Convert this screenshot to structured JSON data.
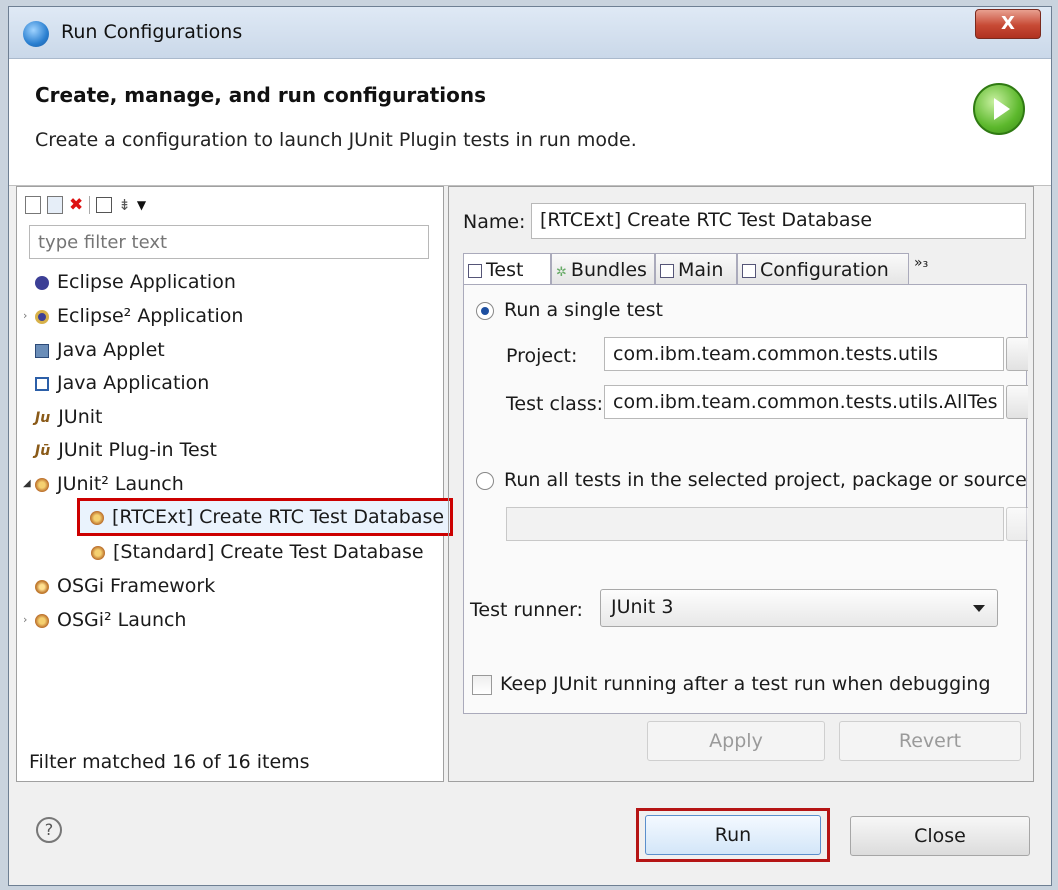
{
  "window": {
    "title": "Run Configurations",
    "close_label": "X"
  },
  "header": {
    "title": "Create, manage, and run configurations",
    "description": "Create a configuration to launch JUnit Plugin tests in run mode."
  },
  "left": {
    "filter_placeholder": "type filter text",
    "filter_status": "Filter matched 16 of 16 items",
    "tree": [
      {
        "label": "Eclipse Application"
      },
      {
        "label": "Eclipse² Application"
      },
      {
        "label": "Java Applet"
      },
      {
        "label": "Java Application"
      },
      {
        "label": "JUnit",
        "icon_text": "Ju"
      },
      {
        "label": "JUnit Plug-in Test",
        "icon_text": "Jū"
      },
      {
        "label": "JUnit² Launch"
      },
      {
        "label": "[RTCExt] Create RTC Test Database",
        "selected": true
      },
      {
        "label": "[Standard] Create Test Database"
      },
      {
        "label": "OSGi Framework"
      },
      {
        "label": "OSGi² Launch"
      }
    ]
  },
  "right": {
    "name_label": "Name:",
    "name_value": "[RTCExt] Create RTC Test Database",
    "tabs": [
      "Test",
      "Bundles",
      "Main",
      "Configuration"
    ],
    "tab_more": "»₃",
    "run_single_label": "Run a single test",
    "project_label": "Project:",
    "project_value": "com.ibm.team.common.tests.utils",
    "test_class_label": "Test class:",
    "test_class_value": "com.ibm.team.common.tests.utils.AllTes",
    "run_all_label": "Run all tests in the selected project, package or source f",
    "test_runner_label": "Test runner:",
    "test_runner_value": "JUnit 3",
    "keep_running_label": "Keep JUnit running after a test run when debugging",
    "apply_label": "Apply",
    "revert_label": "Revert"
  },
  "footer": {
    "help_label": "?",
    "run_label": "Run",
    "close_label": "Close"
  },
  "colors": {
    "highlight_border": "#b51414",
    "title_bar": "#cad8e9",
    "close_button": "#c74a35"
  }
}
